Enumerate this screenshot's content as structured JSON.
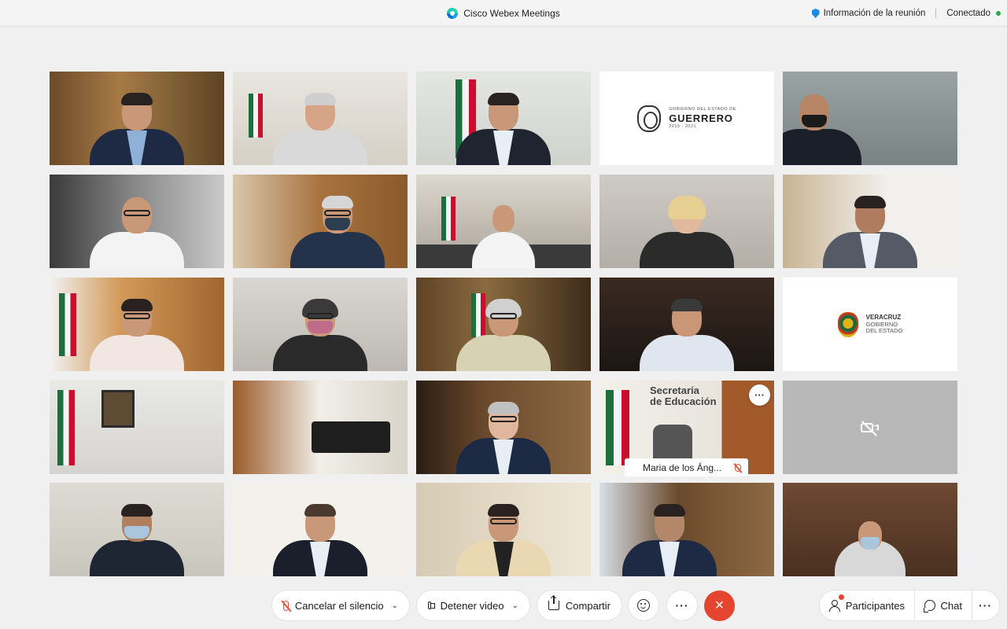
{
  "window": {
    "app_title": "Cisco Webex Meetings",
    "meeting_info_label": "Información de la reunión",
    "connection_status": "Conectado",
    "status_color": "#2ca84a"
  },
  "tiles": {
    "guerrero": {
      "small_top": "GOBIERNO DEL ESTADO DE",
      "name": "GUERRERO",
      "small_bottom": "2015 - 2021"
    },
    "veracruz": {
      "line1": "VERACRUZ",
      "line2": "GOBIERNO",
      "line3": "DEL ESTADO"
    },
    "active_speaker_label": "Maria de los Áng...",
    "more_glyph": "···"
  },
  "controls": {
    "unmute_label": "Cancelar el silencio",
    "stop_video_label": "Detener video",
    "share_label": "Compartir",
    "more_glyph": "···",
    "end_glyph": "×",
    "participants_label": "Participantes",
    "chat_label": "Chat",
    "dropdown_glyph": "⌄",
    "end_color": "#e5452f"
  }
}
